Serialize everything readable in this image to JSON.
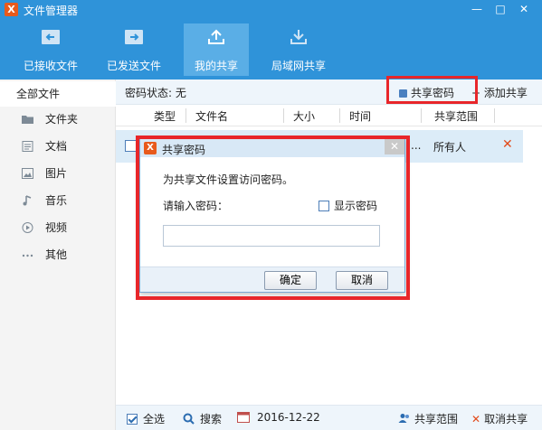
{
  "window": {
    "title": "文件管理器",
    "logo": "X"
  },
  "toolbar": {
    "items": [
      {
        "label": "已接收文件",
        "icon": "received-files-icon"
      },
      {
        "label": "已发送文件",
        "icon": "sent-files-icon"
      },
      {
        "label": "我的共享",
        "icon": "upload-share-icon",
        "active": true
      },
      {
        "label": "局域网共享",
        "icon": "download-lan-icon"
      }
    ]
  },
  "sidebar": {
    "all_files": "全部文件",
    "items": [
      {
        "label": "文件夹",
        "icon": "folder-icon"
      },
      {
        "label": "文档",
        "icon": "document-icon"
      },
      {
        "label": "图片",
        "icon": "image-icon"
      },
      {
        "label": "音乐",
        "icon": "music-icon"
      },
      {
        "label": "视频",
        "icon": "video-icon"
      },
      {
        "label": "其他",
        "icon": "more-icon"
      }
    ]
  },
  "main": {
    "password_status": "密码状态: 无",
    "share_password": "共享密码",
    "add_share": "+ 添加共享",
    "columns": [
      "类型",
      "文件名",
      "大小",
      "时间",
      "共享范围"
    ],
    "row": {
      "dots": "...",
      "scope": "所有人",
      "delete": "✕"
    }
  },
  "dialog": {
    "title": "共享密码",
    "description": "为共享文件设置访问密码。",
    "prompt": "请输入密码：",
    "show_password": "显示密码",
    "input_value": "",
    "confirm": "确定",
    "cancel": "取消"
  },
  "footer": {
    "select_all": "全选",
    "search": "搜索",
    "date": "2016-12-22",
    "share_scope": "共享范围",
    "cancel_share": "取消共享"
  },
  "colors": {
    "accent": "#2f93d9",
    "highlight": "#e8262a",
    "delete": "#e24a1a"
  }
}
